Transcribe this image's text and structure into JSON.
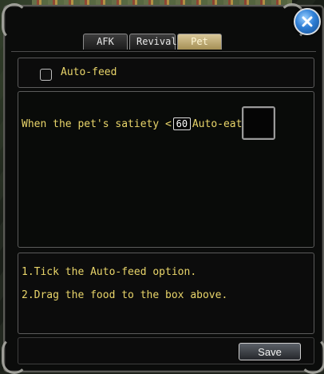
{
  "tabs": [
    {
      "label": "AFK",
      "active": false
    },
    {
      "label": "Revival",
      "active": false
    },
    {
      "label": "Pet",
      "active": true
    }
  ],
  "autofeed": {
    "label": "Auto-feed",
    "checked": false
  },
  "rule": {
    "prefix": "When the pet's satiety <",
    "threshold": "60",
    "suffix": "Auto-eat"
  },
  "instructions": [
    "1.Tick the Auto-feed option.",
    "2.Drag the food to the box above."
  ],
  "save_label": "Save",
  "icons": {
    "close": "close-x-icon"
  },
  "colors": {
    "text_yellow": "#e9d56a",
    "active_tab": "#d9c89a",
    "close_blue": "#2f7fd6"
  }
}
